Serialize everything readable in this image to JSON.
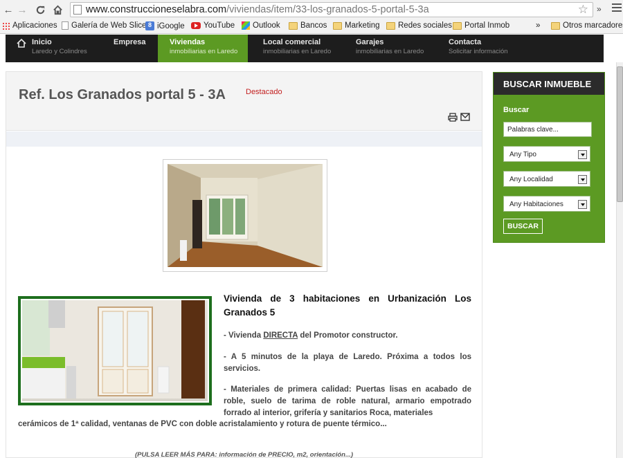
{
  "browser": {
    "url_host": "www.construccioneselabra.com",
    "url_path": "/viviendas/item/33-los-granados-5-portal-5-3a",
    "ext_label": "»",
    "bookmarks": [
      {
        "label": "Aplicaciones",
        "icon": "apps-icon"
      },
      {
        "label": "Galería de Web Slice",
        "icon": "page-icon"
      },
      {
        "label": "iGoogle",
        "icon": "google-icon"
      },
      {
        "label": "YouTube",
        "icon": "youtube-icon"
      },
      {
        "label": "Outlook",
        "icon": "outlook-icon"
      },
      {
        "label": "Bancos",
        "icon": "folder-icon"
      },
      {
        "label": "Marketing",
        "icon": "folder-icon"
      },
      {
        "label": "Redes sociales",
        "icon": "folder-icon"
      },
      {
        "label": "Portal Inmob",
        "icon": "folder-icon"
      },
      {
        "label": "Otros marcadores",
        "icon": "folder-icon"
      }
    ],
    "bookmarks_overflow": "»"
  },
  "nav": {
    "items": [
      {
        "title": "Inicio",
        "sub": "Laredo y Colindres"
      },
      {
        "title": "Empresa",
        "sub": ""
      },
      {
        "title": "Viviendas",
        "sub": "inmobiliarias en Laredo"
      },
      {
        "title": "Local comercial",
        "sub": "inmobiliarias en Laredo"
      },
      {
        "title": "Garajes",
        "sub": "inmobiliarias en Laredo"
      },
      {
        "title": "Contacta",
        "sub": "Solicitar información"
      }
    ],
    "active_index": 2
  },
  "article": {
    "title": "Ref. Los Granados portal 5 - 3A",
    "badge": "Destacado",
    "heading": "Vivienda de 3 habitaciones en Urbanización Los Granados 5",
    "p1_prefix": "- Vivienda ",
    "p1_link": "DIRECTA",
    "p1_suffix": " del Promotor constructor.",
    "p2": "- A 5 minutos de la playa de Laredo. Próxima a todos los servicios.",
    "p3a": "- Materiales de primera calidad: Puertas lisas en acabado de roble, suelo de tarima de roble natural, armario empotrado forrado al interior, grifería y sanitarios Roca, materiales",
    "p3b": "cerámicos de 1ª calidad, ventanas de PVC con doble acristalamiento y rotura de puente térmico...",
    "more": "(PULSA LEER MÁS PARA: información de PRECIO, m2, orientación...)"
  },
  "search": {
    "heading": "BUSCAR INMUEBLE",
    "label": "Buscar",
    "keywords_value": "Palabras clave...",
    "tipo": "Any Tipo",
    "localidad": "Any Localidad",
    "habitaciones": "Any Habitaciones",
    "button": "BUSCAR"
  },
  "colors": {
    "accent_green": "#5c9a23",
    "nav_dark": "#1d1d1d",
    "badge_red": "#c21d1d"
  }
}
